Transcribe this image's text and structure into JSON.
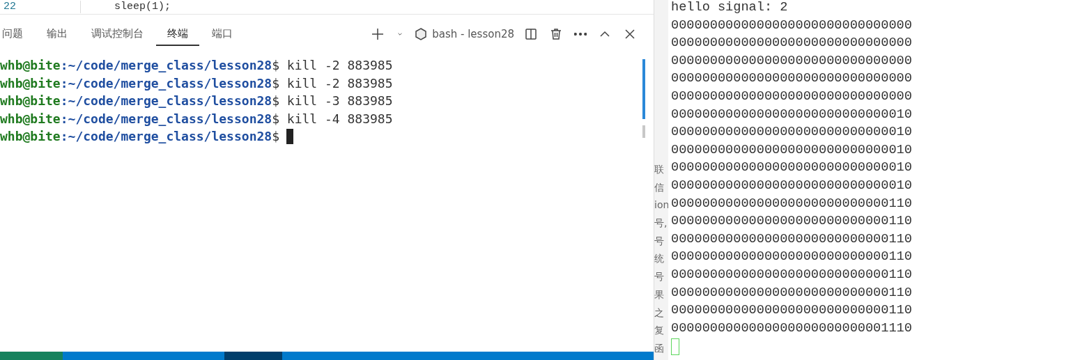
{
  "editor": {
    "line_number": "22",
    "code": "sleep(1);"
  },
  "panel": {
    "tabs": [
      {
        "label": "问题",
        "selected": false
      },
      {
        "label": "输出",
        "selected": false
      },
      {
        "label": "调试控制台",
        "selected": false
      },
      {
        "label": "终端",
        "selected": true
      },
      {
        "label": "端口",
        "selected": false
      }
    ],
    "terminal_name": "bash - lesson28",
    "lines": [
      {
        "user": "whb@bite",
        "path": ":~/code/merge_class/lesson28",
        "prompt": "$",
        "command": "kill -2 883985"
      },
      {
        "user": "whb@bite",
        "path": ":~/code/merge_class/lesson28",
        "prompt": "$",
        "command": "kill -2 883985"
      },
      {
        "user": "whb@bite",
        "path": ":~/code/merge_class/lesson28",
        "prompt": "$",
        "command": "kill -3 883985"
      },
      {
        "user": "whb@bite",
        "path": ":~/code/merge_class/lesson28",
        "prompt": "$",
        "command": "kill -4 883985"
      },
      {
        "user": "whb@bite",
        "path": ":~/code/merge_class/lesson28",
        "prompt": "$"
      }
    ]
  },
  "side_fragments": [
    "联",
    "信",
    "ion",
    "号,",
    "号",
    "统",
    "号",
    "果",
    "之",
    "复",
    "函"
  ],
  "output": {
    "lines": [
      "hello signal: 2",
      "0000000000000000000000000000000",
      "0000000000000000000000000000000",
      "0000000000000000000000000000000",
      "0000000000000000000000000000000",
      "0000000000000000000000000000000",
      "0000000000000000000000000000010",
      "0000000000000000000000000000010",
      "0000000000000000000000000000010",
      "0000000000000000000000000000010",
      "0000000000000000000000000000010",
      "0000000000000000000000000000110",
      "0000000000000000000000000000110",
      "0000000000000000000000000000110",
      "0000000000000000000000000000110",
      "0000000000000000000000000000110",
      "0000000000000000000000000000110",
      "0000000000000000000000000000110",
      "0000000000000000000000000001110"
    ]
  }
}
